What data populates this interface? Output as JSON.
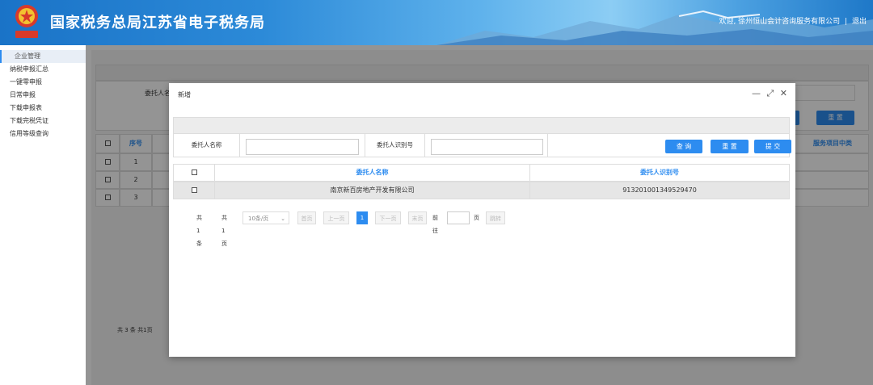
{
  "header": {
    "title": "国家税务总局江苏省电子税务局",
    "welcome": "欢迎, 徐州恒山会计咨询服务有限公司",
    "separator": "|",
    "logout": "退出",
    "emblem_text": "中国税务"
  },
  "sidebar": {
    "items": [
      {
        "label": "企业管理"
      },
      {
        "label": "纳税申报汇总"
      },
      {
        "label": "一键零申报"
      },
      {
        "label": "日常申报"
      },
      {
        "label": "下载申报表"
      },
      {
        "label": "下载完税凭证"
      },
      {
        "label": "信用等级查询"
      }
    ]
  },
  "background": {
    "filter_label": "委托人名",
    "reset_button": "重 置",
    "table_headers": {
      "index": "序号",
      "service_type": "服务项目中类"
    },
    "rows": [
      "1",
      "2",
      "3"
    ],
    "pager_text": "共 3 条  共1页"
  },
  "modal": {
    "title": "新增",
    "controls": {
      "minimize": "—",
      "maximize": "⤢",
      "close": "✕"
    },
    "search": {
      "name_label": "委托人名称",
      "name_value": "",
      "id_label": "委托人识别号",
      "id_value": "",
      "query_button": "查 询",
      "reset_button": "重 置",
      "submit_button": "提 交"
    },
    "table": {
      "headers": {
        "name": "委托人名称",
        "id": "委托人识别号"
      },
      "rows": [
        {
          "name": "南京新百房地产开发有限公司",
          "id": "913201001349529470"
        }
      ]
    },
    "pager": {
      "total": "共 1 条",
      "pages": "共1页",
      "page_size": "10条/页",
      "first": "首页",
      "prev": "上一页",
      "current": "1",
      "next": "下一页",
      "last": "末页",
      "goto_label": "前往",
      "goto_value": "",
      "page_unit": "页",
      "jump": "跳转"
    }
  },
  "colors": {
    "accent": "#2d8cf0",
    "header_blue": "#1a73c7"
  }
}
